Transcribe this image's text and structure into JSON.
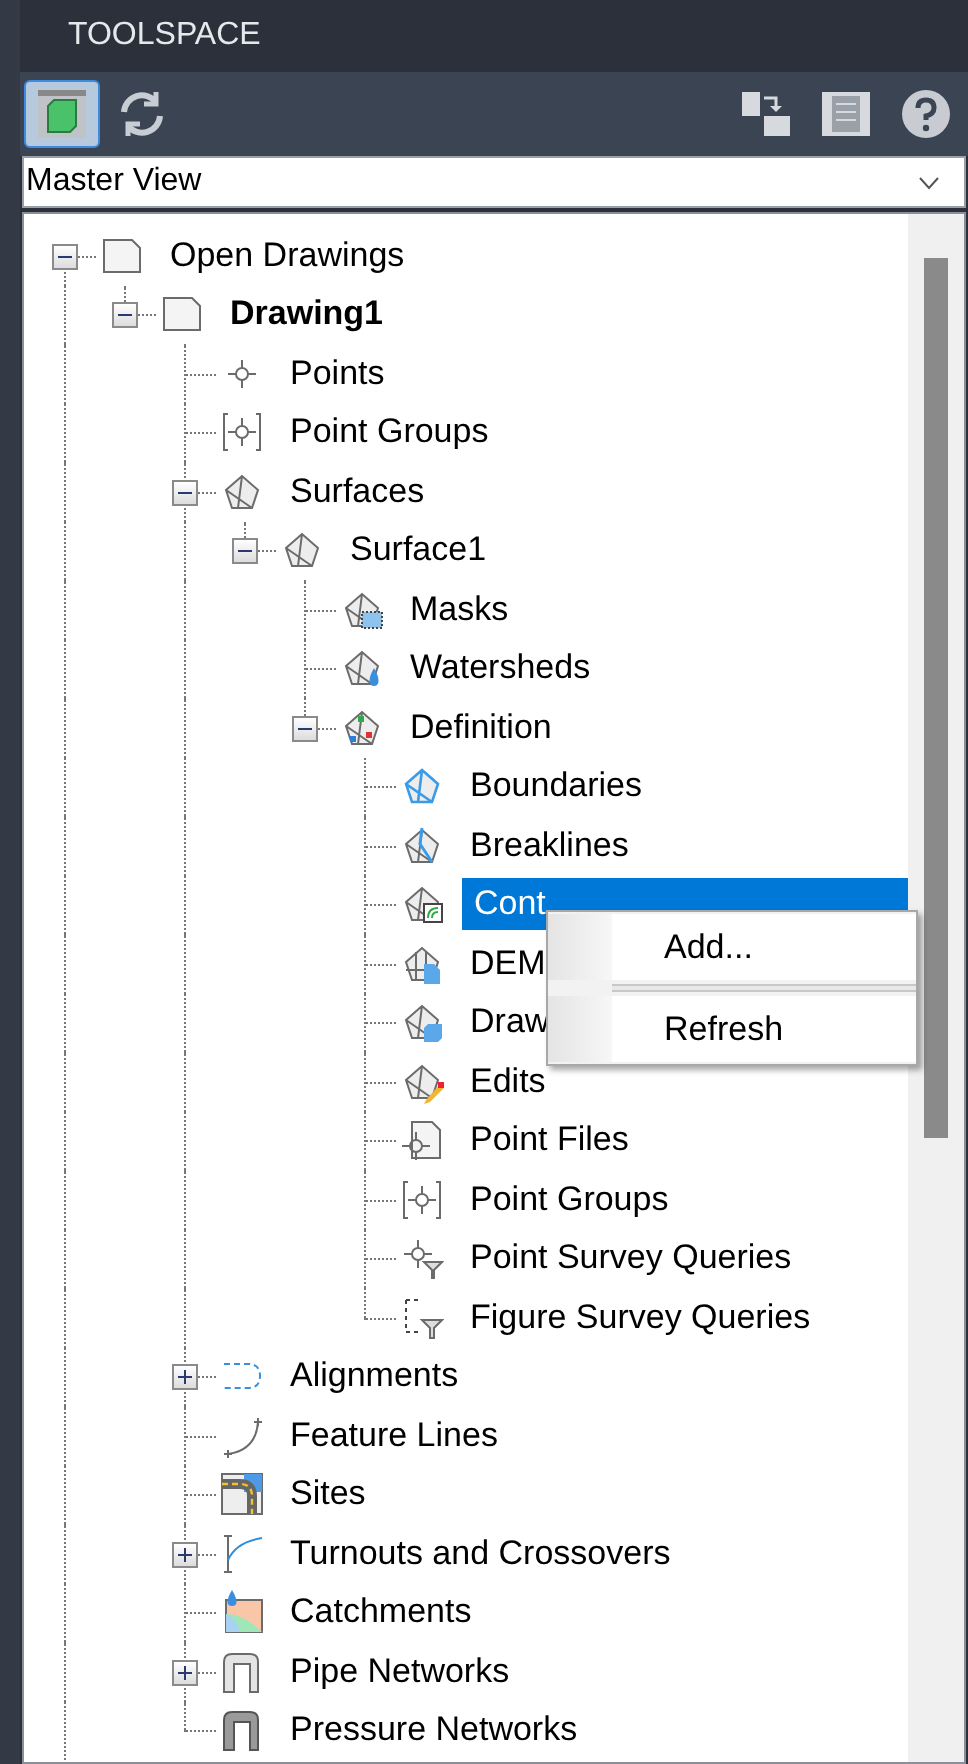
{
  "window": {
    "title": "TOOLSPACE"
  },
  "toolbar": [
    {
      "kind": "prospector",
      "selected": true
    },
    {
      "kind": "refresh",
      "selected": false
    },
    {
      "kind": "import",
      "selected": false
    },
    {
      "kind": "panel",
      "selected": false
    },
    {
      "kind": "help",
      "selected": false
    }
  ],
  "view_select": {
    "value": "Master View"
  },
  "tree": [
    {
      "label": "Open Drawings",
      "kind": "document",
      "expanded": true,
      "selected": false,
      "children": [
        {
          "label": "Drawing1",
          "kind": "document",
          "expanded": true,
          "selected": false,
          "current": true,
          "children": [
            {
              "label": "Points",
              "kind": "point",
              "selected": false
            },
            {
              "label": "Point Groups",
              "kind": "point-group",
              "selected": false
            },
            {
              "label": "Surfaces",
              "kind": "surface",
              "expanded": true,
              "selected": false,
              "children": [
                {
                  "label": "Surface1",
                  "kind": "surface",
                  "expanded": true,
                  "selected": false,
                  "children": [
                    {
                      "label": "Masks",
                      "kind": "mask",
                      "selected": false
                    },
                    {
                      "label": "Watersheds",
                      "kind": "watershed",
                      "selected": false
                    },
                    {
                      "label": "Definition",
                      "kind": "definition",
                      "expanded": true,
                      "selected": false,
                      "children": [
                        {
                          "label": "Boundaries",
                          "kind": "boundary",
                          "selected": false
                        },
                        {
                          "label": "Breaklines",
                          "kind": "breakline",
                          "selected": false
                        },
                        {
                          "label": "Cont",
                          "kind": "contour",
                          "selected": true
                        },
                        {
                          "label": "DEM",
                          "kind": "dem",
                          "selected": false
                        },
                        {
                          "label": "Draw",
                          "kind": "drawing-object",
                          "selected": false
                        },
                        {
                          "label": "Edits",
                          "kind": "edit",
                          "selected": false
                        },
                        {
                          "label": "Point Files",
                          "kind": "point-file",
                          "selected": false
                        },
                        {
                          "label": "Point Groups",
                          "kind": "point-group",
                          "selected": false
                        },
                        {
                          "label": "Point Survey Queries",
                          "kind": "point-query",
                          "selected": false
                        },
                        {
                          "label": "Figure Survey Queries",
                          "kind": "figure-query",
                          "selected": false
                        }
                      ]
                    }
                  ]
                }
              ]
            },
            {
              "label": "Alignments",
              "kind": "alignment",
              "expanded": false,
              "selected": false
            },
            {
              "label": "Feature Lines",
              "kind": "feature-line",
              "selected": false
            },
            {
              "label": "Sites",
              "kind": "site",
              "selected": false
            },
            {
              "label": "Turnouts and Crossovers",
              "kind": "turnout",
              "expanded": false,
              "selected": false
            },
            {
              "label": "Catchments",
              "kind": "catchment",
              "selected": false
            },
            {
              "label": "Pipe Networks",
              "kind": "pipe",
              "expanded": false,
              "selected": false
            },
            {
              "label": "Pressure Networks",
              "kind": "pressure",
              "selected": false
            }
          ]
        }
      ]
    }
  ],
  "context_menu": [
    {
      "kind": "item",
      "label": "Add..."
    },
    {
      "kind": "separator"
    },
    {
      "kind": "item",
      "label": "Refresh"
    }
  ]
}
